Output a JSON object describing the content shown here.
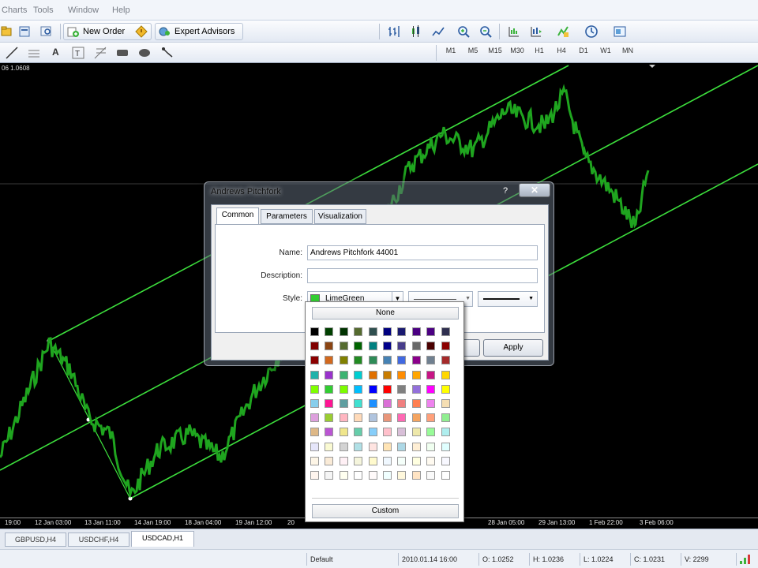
{
  "menu": {
    "items": [
      "Charts",
      "Tools",
      "Window",
      "Help"
    ]
  },
  "toolbar": {
    "new_order_label": "New Order",
    "expert_advisors_label": "Expert Advisors",
    "timeframes": [
      "M1",
      "M5",
      "M15",
      "M30",
      "H1",
      "H4",
      "D1",
      "W1",
      "MN"
    ]
  },
  "chart": {
    "header": "06 1.0608",
    "x_labels": [
      "19:00",
      "12 Jan 03:00",
      "13 Jan 11:00",
      "14 Jan 19:00",
      "18 Jan 04:00",
      "19 Jan 12:00",
      "20",
      "28 Jan 05:00",
      "29 Jan 13:00",
      "1 Feb 22:00",
      "3 Feb 06:00"
    ],
    "line_color": "#2bd62b",
    "price_color": "#1a9a1a"
  },
  "tabs": [
    "GBPUSD,H4",
    "USDCHF,H4",
    "USDCAD,H1"
  ],
  "status": {
    "profile": "Default",
    "datetime": "2010.01.14 16:00",
    "open": "O: 1.0252",
    "high": "H: 1.0236",
    "low": "L: 1.0224",
    "close": "C: 1.0231",
    "volume": "V: 2299"
  },
  "dialog": {
    "title": "Andrews Pitchfork",
    "help": "?",
    "close": "✕",
    "tabs": [
      "Common",
      "Parameters",
      "Visualization"
    ],
    "name_label": "Name:",
    "name_value": "Andrews Pitchfork 44001",
    "description_label": "Description:",
    "description_value": "",
    "style_label": "Style:",
    "style_color_name": "LimeGreen",
    "style_color": "#32cd32",
    "apply_label": "Apply"
  },
  "color_popup": {
    "none_label": "None",
    "custom_label": "Custom",
    "grid": [
      [
        "#000000",
        "#004000",
        "#003300",
        "#556b2f",
        "#2f4f4f",
        "#000080",
        "#191970",
        "#4b0082",
        "#4b0082",
        "#2f2f4f"
      ],
      [
        "#800000",
        "#8b4513",
        "#556b2f",
        "#006400",
        "#008080",
        "#00008b",
        "#483d8b",
        "#696969",
        "#4a0000",
        "#8b0000"
      ],
      [
        "#8b0000",
        "#d2691e",
        "#808000",
        "#228b22",
        "#2e8b57",
        "#4682b4",
        "#4169e1",
        "#8b008b",
        "#708090",
        "#a52a2a"
      ],
      [
        "#20b2aa",
        "#9932cc",
        "#3cb371",
        "#00ced1",
        "#e07000",
        "#c87c00",
        "#ff8c00",
        "#ffa500",
        "#c71585",
        "#ffd700"
      ],
      [
        "#7fff00",
        "#32cd32",
        "#7cfc00",
        "#00bfff",
        "#0000ff",
        "#ff0000",
        "#808080",
        "#9370db",
        "#ff00ff",
        "#ffff00"
      ],
      [
        "#87ceeb",
        "#ff1493",
        "#5f9ea0",
        "#40e0d0",
        "#1e90ff",
        "#da70d6",
        "#f08080",
        "#ff7f50",
        "#ee82ee",
        "#f5deb3"
      ],
      [
        "#dda0dd",
        "#9acd32",
        "#ffb6c1",
        "#ffdab9",
        "#b0c4de",
        "#e9967a",
        "#ff69b4",
        "#f4a460",
        "#ffa07a",
        "#90ee90"
      ],
      [
        "#deb887",
        "#ba55d3",
        "#f0e68c",
        "#66cdaa",
        "#87cefa",
        "#ffc0cb",
        "#d8bfd8",
        "#eee8aa",
        "#98fb98",
        "#afeeee"
      ],
      [
        "#e6e6fa",
        "#fafad2",
        "#d3d3d3",
        "#b0e0e6",
        "#ffe4e1",
        "#ffe4b5",
        "#add8e6",
        "#ffefd5",
        "#f0fff0",
        "#e0ffff"
      ],
      [
        "#fdf5e6",
        "#faebd7",
        "#fff0f5",
        "#f5f5dc",
        "#fffacd",
        "#f0f8ff",
        "#f5fffa",
        "#ffffe0",
        "#fffaf0",
        "#f8f8ff"
      ],
      [
        "#fff5ee",
        "#f5f5f5",
        "#fffff0",
        "#ffffff",
        "#fffafa",
        "#f0ffff",
        "#fff8dc",
        "#ffe4c4",
        "#fafafa",
        "#ffffff"
      ]
    ]
  }
}
